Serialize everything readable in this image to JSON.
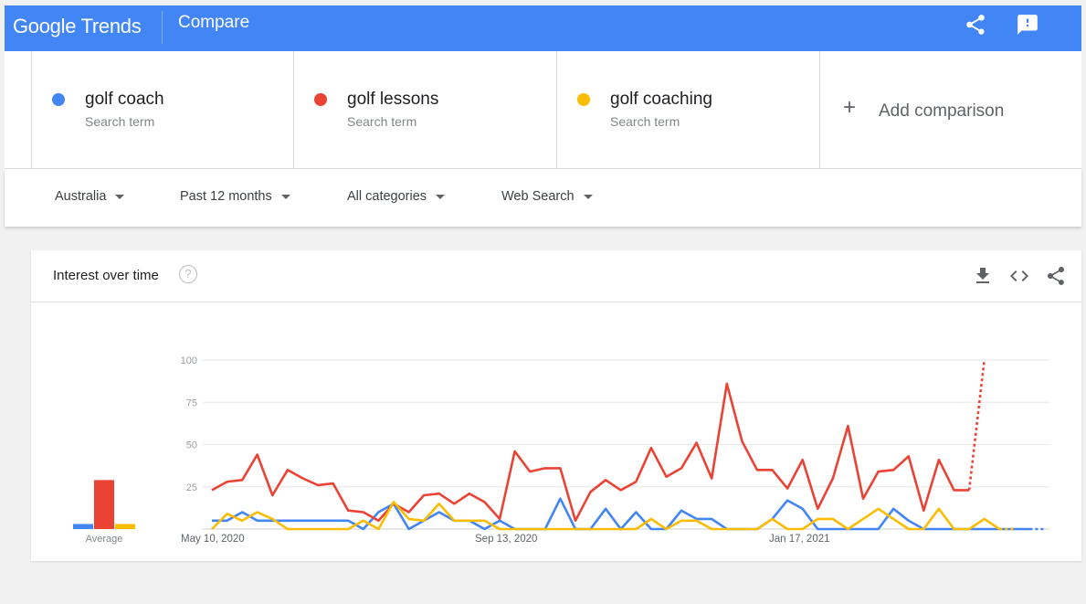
{
  "header": {
    "logo_google": "Google",
    "logo_trends": "Trends",
    "title": "Compare",
    "share_icon": "share-icon",
    "feedback_icon": "feedback-icon",
    "color": "#4285f4"
  },
  "terms": [
    {
      "name": "golf coach",
      "sub": "Search term",
      "color": "#4285f4"
    },
    {
      "name": "golf lessons",
      "sub": "Search term",
      "color": "#ea4335"
    },
    {
      "name": "golf coaching",
      "sub": "Search term",
      "color": "#fbbc04"
    }
  ],
  "add_comparison": {
    "label": "Add comparison",
    "icon": "plus-icon"
  },
  "filters": {
    "region": "Australia",
    "time": "Past 12 months",
    "category": "All categories",
    "property": "Web Search"
  },
  "card": {
    "title": "Interest over time",
    "help_icon": "help-icon",
    "download_icon": "download-icon",
    "embed_icon": "embed-icon",
    "share_icon": "share-icon"
  },
  "chart_data": {
    "type": "line",
    "y_ticks": [
      "100",
      "75",
      "50",
      "25"
    ],
    "ylim": [
      0,
      100
    ],
    "x_labels": [
      "May 10, 2020",
      "Sep 13, 2020",
      "Jan 17, 2021"
    ],
    "average_label": "Average",
    "averages": [
      3,
      29,
      3
    ],
    "partial_last_point": true,
    "series": [
      {
        "color": "#4285f4",
        "values": [
          5,
          5,
          10,
          5,
          5,
          5,
          5,
          5,
          5,
          5,
          0,
          10,
          15,
          0,
          5,
          10,
          5,
          5,
          0,
          5,
          0,
          0,
          0,
          18,
          0,
          0,
          12,
          0,
          10,
          0,
          0,
          11,
          6,
          6,
          0,
          0,
          0,
          6,
          17,
          12,
          0,
          0,
          0,
          0,
          0,
          12,
          5,
          0,
          0,
          0,
          0,
          0,
          0,
          0,
          0,
          0
        ]
      },
      {
        "color": "#ea4335",
        "values": [
          23,
          28,
          29,
          44,
          20,
          35,
          30,
          26,
          27,
          11,
          10,
          5,
          15,
          10,
          20,
          21,
          15,
          21,
          16,
          6,
          46,
          34,
          36,
          36,
          5,
          22,
          29,
          23,
          28,
          48,
          31,
          36,
          51,
          30,
          86,
          52,
          35,
          35,
          24,
          41,
          12,
          30,
          61,
          18,
          34,
          35,
          43,
          11,
          41,
          23,
          23,
          100
        ]
      },
      {
        "color": "#fbbc04",
        "values": [
          0,
          9,
          5,
          10,
          6,
          0,
          0,
          0,
          0,
          0,
          5,
          0,
          16,
          6,
          5,
          15,
          5,
          5,
          5,
          0,
          0,
          0,
          0,
          0,
          0,
          0,
          0,
          0,
          0,
          6,
          0,
          5,
          5,
          0,
          0,
          0,
          0,
          6,
          0,
          0,
          6,
          6,
          0,
          6,
          12,
          6,
          0,
          0,
          12,
          0,
          0,
          6,
          0,
          0
        ]
      }
    ]
  }
}
